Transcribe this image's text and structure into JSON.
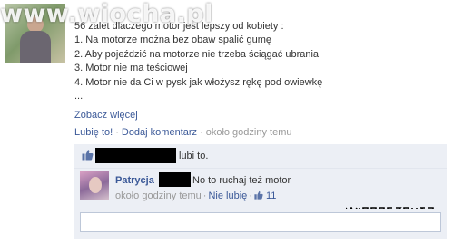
{
  "watermark": "www.wiocha.pl",
  "post": {
    "title": "56 zalet dlaczego motor jest lepszy od kobiety :",
    "lines": [
      "1. Na motorze można bez obaw spalić gumę",
      "2. Aby pojeździć na motorze nie trzeba ściągać ubrania",
      "3. Motor nie ma teściowej",
      "4. Motor nie da Ci w pysk jak włożysz rękę pod owiewkę",
      "..."
    ],
    "more_label": "Zobacz więcej"
  },
  "actions": {
    "like_label": "Lubię to!",
    "comment_label": "Dodaj komentarz",
    "time": "około godziny temu",
    "separator": "·"
  },
  "likes": {
    "text": "lubi to."
  },
  "comment": {
    "author": "Patrycja",
    "text": "No to ruchaj też motor",
    "time": "około godziny temu",
    "unlike_label": "Nie lubię",
    "like_count": "11",
    "separator": "·"
  },
  "colors": {
    "link": "#3b5998",
    "panel": "#eceff5",
    "muted": "#999999"
  }
}
